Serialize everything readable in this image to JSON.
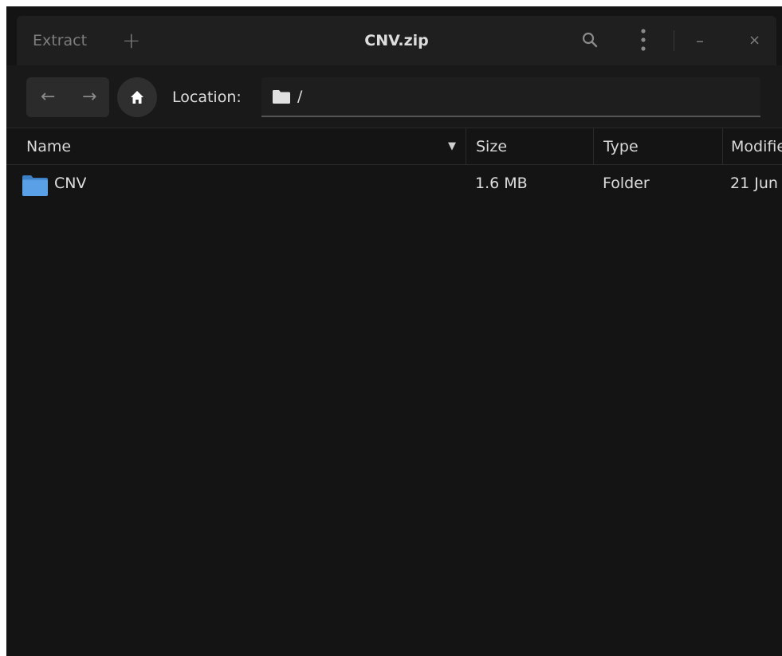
{
  "window": {
    "title": "CNV.zip"
  },
  "header": {
    "extract_label": "Extract",
    "add_label": "+",
    "search_icon": "search-icon",
    "menu_icon": "kebab-menu-icon",
    "minimize_label": "–",
    "close_label": "×"
  },
  "location": {
    "back_label": "←",
    "forward_label": "→",
    "label": "Location:",
    "path": "/"
  },
  "columns": {
    "name": "Name",
    "size": "Size",
    "type": "Type",
    "modified": "Modified"
  },
  "rows": [
    {
      "name": "CNV",
      "size": "1.6 MB",
      "type": "Folder",
      "modified": "21 Jun",
      "icon": "folder-icon"
    }
  ],
  "colors": {
    "folder_blue": "#4a90d9",
    "window_bg": "#141414",
    "header_bg": "#1f1f1f"
  }
}
